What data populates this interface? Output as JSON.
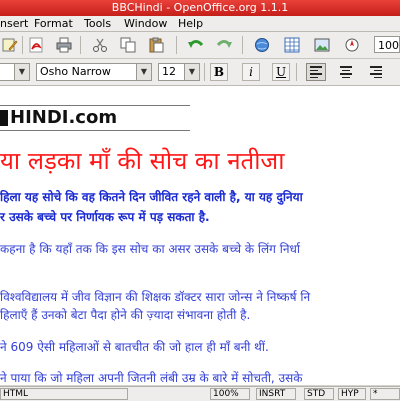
{
  "window": {
    "title": "BBCHindi - OpenOffice.org 1.1.1"
  },
  "menu": {
    "items": [
      "nsert",
      "Format",
      "Tools",
      "Window",
      "Help"
    ]
  },
  "toolbar": {
    "zoom": "100"
  },
  "format": {
    "style": "",
    "font": "Osho Narrow",
    "size": "12",
    "bold": "B",
    "italic": "i",
    "underline": "U"
  },
  "document": {
    "logo_text": "HINDI.com",
    "heading": "या लड़का माँ की सोच का नतीजा",
    "intro_line1": "हिला यह सोचे कि वह कितने दिन जीवित रहने वाली है, या यह दुनिया",
    "intro_line2": "र उसके बच्चे पर निर्णायक रूप में पड़ सकता है.",
    "para1": "कहना है कि यहाँ तक कि इस सोच का असर उसके बच्चे के लिंग निर्धा",
    "para2_line1": "विश्वविद्यालय में जीव विज्ञान की शिक्षक डॉक्टर सारा जोन्स ने निष्कर्ष नि",
    "para2_line2": "हिलाएँ हैं उनको बेटा पैदा होने की ज़्यादा संभावना होती है.",
    "para3": "ने 609 ऐसी महिलाओं से बातचीत की जो हाल ही माँ बनी थीं.",
    "para4": "ने पाया कि जो महिला अपनी जितनी लंबी उम्र के बारे में सोचती, उसके"
  },
  "status": {
    "mode": "HTML",
    "zoom": "100%",
    "insert": "INSRT",
    "std": "STD",
    "hyp": "HYP",
    "mod": "*"
  }
}
